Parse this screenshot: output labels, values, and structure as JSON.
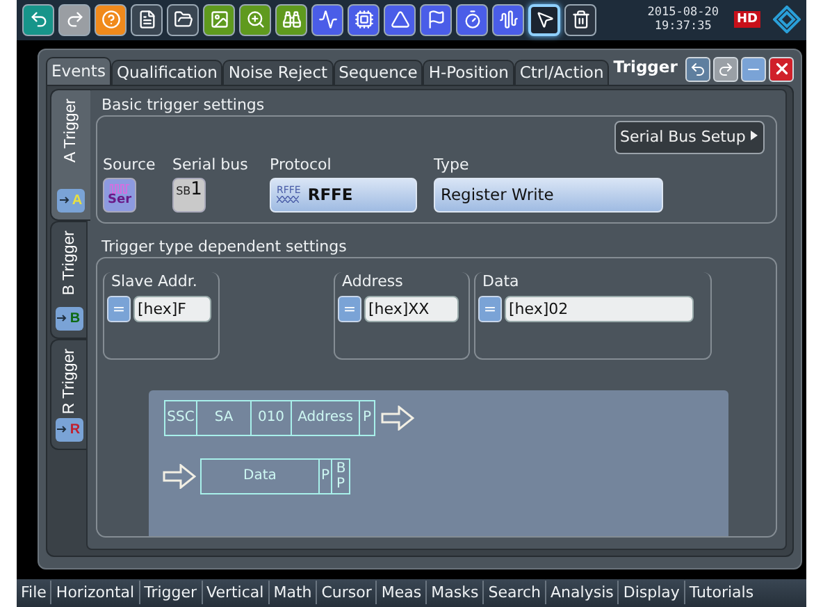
{
  "toolbar": {
    "tools": [
      {
        "color": "#17958a",
        "selected": false
      },
      {
        "color": "#9a9ea3",
        "selected": false
      },
      {
        "color": "#f08a1c",
        "selected": false
      },
      {
        "color": "#3a4652",
        "selected": false
      },
      {
        "color": "#3a4652",
        "selected": false
      },
      {
        "color": "#5f9a1e",
        "selected": false
      },
      {
        "color": "#5f9a1e",
        "selected": false
      },
      {
        "color": "#5f9a1e",
        "selected": false
      },
      {
        "color": "#4a5de8",
        "selected": false
      },
      {
        "color": "#4a5de8",
        "selected": false
      },
      {
        "color": "#4a5de8",
        "selected": false
      },
      {
        "color": "#4a5de8",
        "selected": false
      },
      {
        "color": "#4a5de8",
        "selected": false
      },
      {
        "color": "#4a5de8",
        "selected": false
      },
      {
        "color": "#1b2430",
        "selected": true
      },
      {
        "color": "#2a3440",
        "selected": false
      }
    ],
    "date": "2015-08-20",
    "time": "19:37:35",
    "hd": "HD"
  },
  "dialog": {
    "title": "Trigger",
    "tabs": [
      {
        "label": "Events",
        "selected": true
      },
      {
        "label": "Qualification",
        "selected": false
      },
      {
        "label": "Noise Reject",
        "selected": false
      },
      {
        "label": "Sequence",
        "selected": false
      },
      {
        "label": "H-Position",
        "selected": false
      },
      {
        "label": "Ctrl/Action",
        "selected": false
      }
    ],
    "side_tabs": [
      {
        "label": "A Trigger",
        "selected": true,
        "letter": "A",
        "color": "#e8e040"
      },
      {
        "label": "B Trigger",
        "selected": false,
        "letter": "B",
        "color": "#0e6a14"
      },
      {
        "label": "R Trigger",
        "selected": false,
        "letter": "R",
        "color": "#c02030"
      }
    ],
    "basic": {
      "title": "Basic trigger settings",
      "setup_button": "Serial Bus Setup",
      "source": {
        "label": "Source",
        "icon_text": "Ser"
      },
      "serial_bus": {
        "label": "Serial bus",
        "prefix": "SB",
        "number": "1"
      },
      "protocol": {
        "label": "Protocol",
        "icon_text": "RFFE",
        "value": "RFFE"
      },
      "type": {
        "label": "Type",
        "value": "Register Write"
      }
    },
    "dependent": {
      "title": "Trigger type dependent settings",
      "fields": [
        {
          "label": "Slave Addr.",
          "operator": "=",
          "value": "[hex]F"
        },
        {
          "label": "Address",
          "operator": "=",
          "value": "[hex]XX"
        },
        {
          "label": "Data",
          "operator": "=",
          "value": "[hex]02"
        }
      ],
      "frame": {
        "row_1": [
          "SSC",
          "SA",
          "010",
          "Address",
          "P"
        ],
        "row_2": [
          "Data",
          "P",
          "BP"
        ]
      }
    }
  },
  "menu": [
    "File",
    "Horizontal",
    "Trigger",
    "Vertical",
    "Math",
    "Cursor",
    "Meas",
    "Masks",
    "Search",
    "Analysis",
    "Display",
    "Tutorials"
  ]
}
